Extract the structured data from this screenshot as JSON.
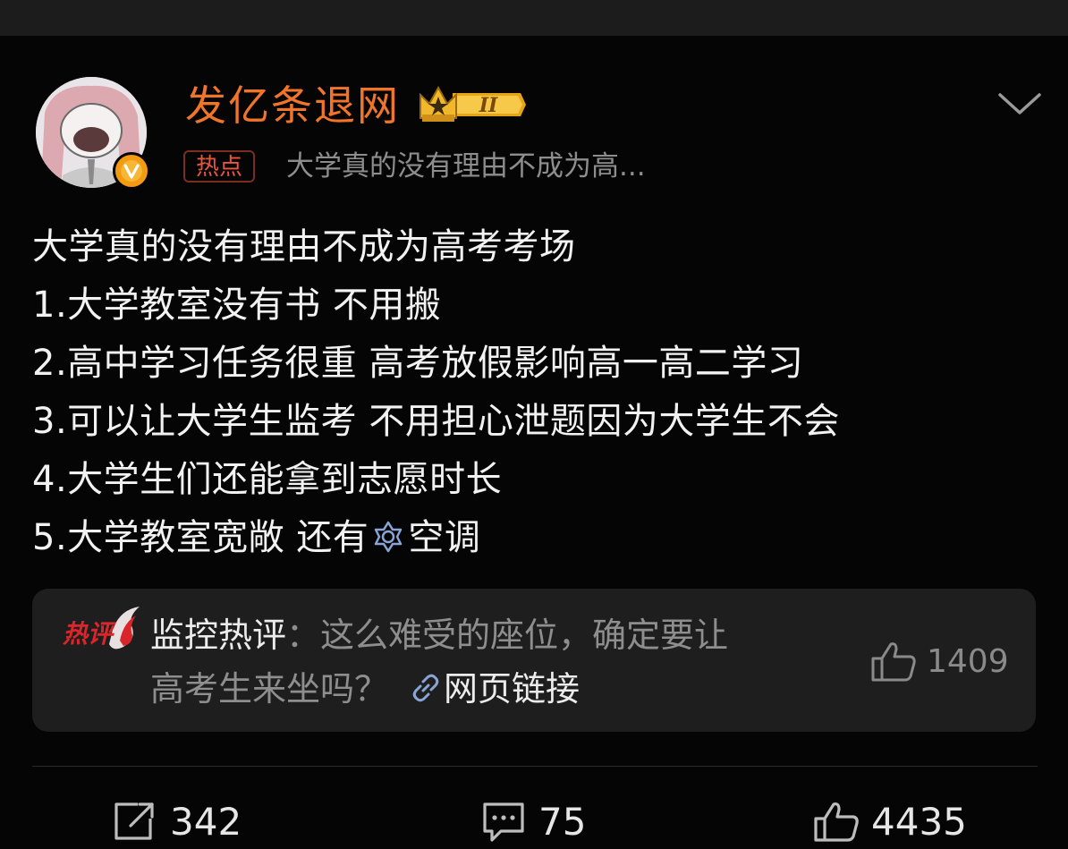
{
  "header": {
    "username": "发亿条退网",
    "level_badge": "II",
    "topic_tag": "热点",
    "topic_text": "大学真的没有理由不成为高..."
  },
  "post": {
    "lines": [
      "大学真的没有理由不成为高考考场",
      "1.大学教室没有书 不用搬",
      "2.高中学习任务很重 高考放假影响高一高二学习",
      "3.可以让大学生监考 不用担心泄题因为大学生不会",
      "4.大学生们还能拿到志愿时长"
    ],
    "line5_before": "5.大学教室宽敞 还有",
    "line5_after": "空调"
  },
  "hot_comment": {
    "logo_text": "热评",
    "author": "监控热评",
    "separator": "：",
    "text_line1": "这么难受的座位，确定要让",
    "text_line2": "高考生来坐吗？",
    "link_label": "网页链接",
    "like_count": "1409"
  },
  "actions": {
    "repost_count": "342",
    "comment_count": "75",
    "like_count": "4435"
  },
  "colors": {
    "username": "#f0752a",
    "tag": "#e8563f",
    "verified": "#f39a12",
    "card_bg": "#1e1e1e"
  },
  "icons": {
    "verified": "verified-v-icon",
    "more": "chevron-down-icon",
    "ac": "air-conditioner-icon",
    "link": "link-icon",
    "like": "thumbs-up-icon",
    "repost": "repost-icon",
    "comment": "comment-icon"
  }
}
